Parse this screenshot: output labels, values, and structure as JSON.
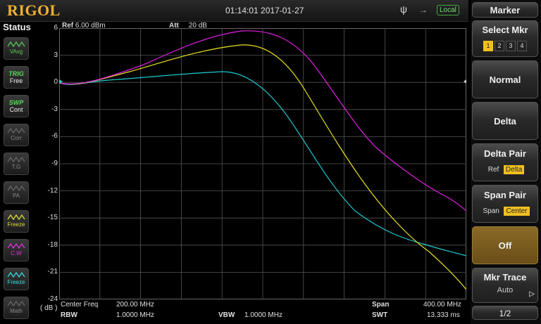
{
  "brand": "RIGOL",
  "status_bar": {
    "datetime": "01:14:01 2017-01-27",
    "mode": "Local"
  },
  "status_panel": {
    "title": "Status",
    "buttons": [
      {
        "line1": "",
        "line2": "VAvg"
      },
      {
        "line1": "TRIG",
        "line2": "Free"
      },
      {
        "line1": "SWP",
        "line2": "Cont"
      },
      {
        "line1": "",
        "line2": "Corr"
      },
      {
        "line1": "",
        "line2": "T.G"
      },
      {
        "line1": "",
        "line2": "PA"
      },
      {
        "line1": "",
        "line2": "Freeze"
      },
      {
        "line1": "",
        "line2": "C.W"
      },
      {
        "line1": "",
        "line2": "Freeze"
      },
      {
        "line1": "",
        "line2": "Math"
      }
    ]
  },
  "plot": {
    "ref_label": "Ref",
    "ref_value": "6.00 dBm",
    "att_label": "Att",
    "att_value": "20 dB",
    "unit": "( dB )",
    "y_ticks": [
      "6",
      "3",
      "0",
      "-3",
      "-6",
      "-9",
      "-12",
      "-15",
      "-18",
      "-21",
      "-24"
    ]
  },
  "bottom": {
    "center_freq_label": "Center Freq",
    "center_freq": "200.00 MHz",
    "rbw_label": "RBW",
    "rbw": "1.0000 MHz",
    "vbw_label": "VBW",
    "vbw": "1.0000 MHz",
    "span_label": "Span",
    "span": "400.00 MHz",
    "swt_label": "SWT",
    "swt": "13.333 ms"
  },
  "menu": {
    "title": "Marker",
    "select_mkr": "Select Mkr",
    "mkr_numbers": [
      "1",
      "2",
      "3",
      "4"
    ],
    "normal": "Normal",
    "delta": "Delta",
    "delta_pair": "Delta Pair",
    "delta_pair_opts": [
      "Ref",
      "Delta"
    ],
    "span_pair": "Span Pair",
    "span_pair_opts": [
      "Span",
      "Center"
    ],
    "off": "Off",
    "mkr_trace": "Mkr Trace",
    "mkr_trace_value": "Auto",
    "page": "1/2"
  },
  "colors": {
    "trace_magenta": "#e020e0",
    "trace_yellow": "#e8e020",
    "trace_cyan": "#20c8d0",
    "accent": "#f0c020"
  }
}
